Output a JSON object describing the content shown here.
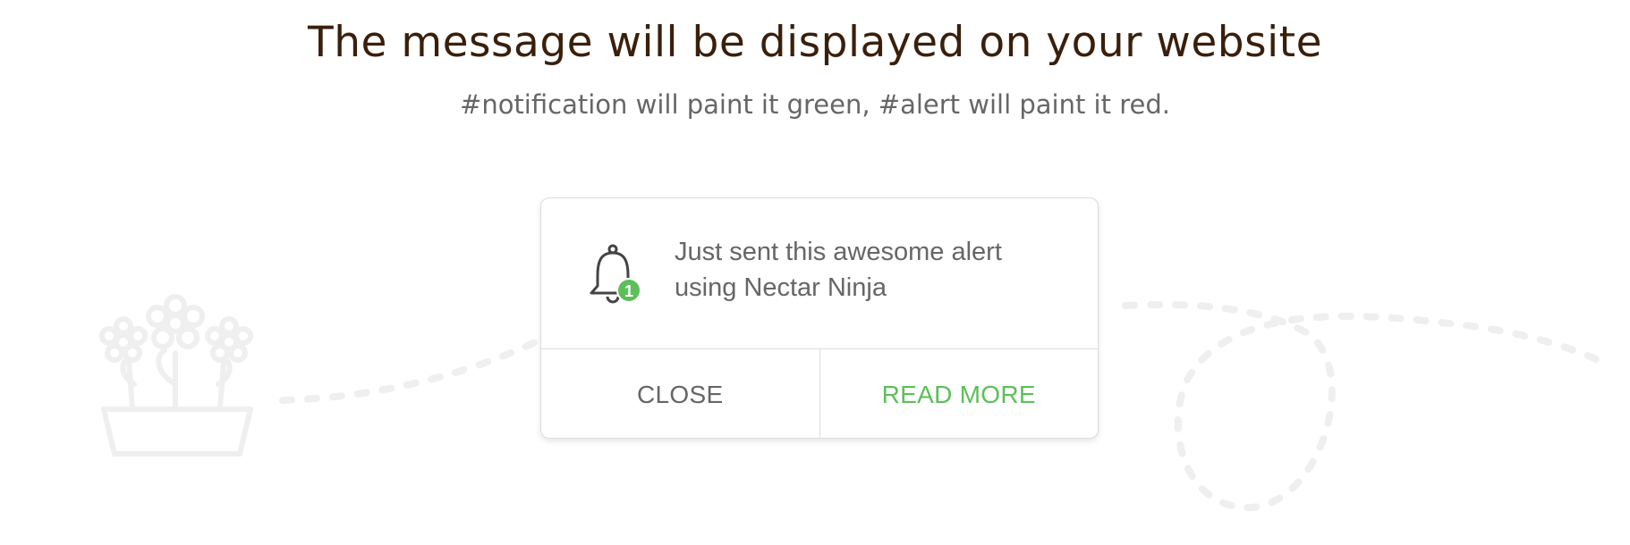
{
  "header": {
    "title": "The message will be displayed on your website",
    "subtitle": "#notification will paint it green, #alert will paint it red."
  },
  "notification": {
    "message": "Just sent this awesome alert using Nectar Ninja",
    "badge_count": "1",
    "close_label": "CLOSE",
    "read_more_label": "READ MORE",
    "icon": "bell-icon"
  },
  "colors": {
    "heading": "#3a1f0b",
    "text": "#666666",
    "accent_green": "#5cbf5a",
    "border": "#dcdcdc",
    "decoration": "#f0f0f0"
  },
  "decorations": {
    "left_icon": "flower-pot-icon",
    "path": "dashed-path"
  }
}
